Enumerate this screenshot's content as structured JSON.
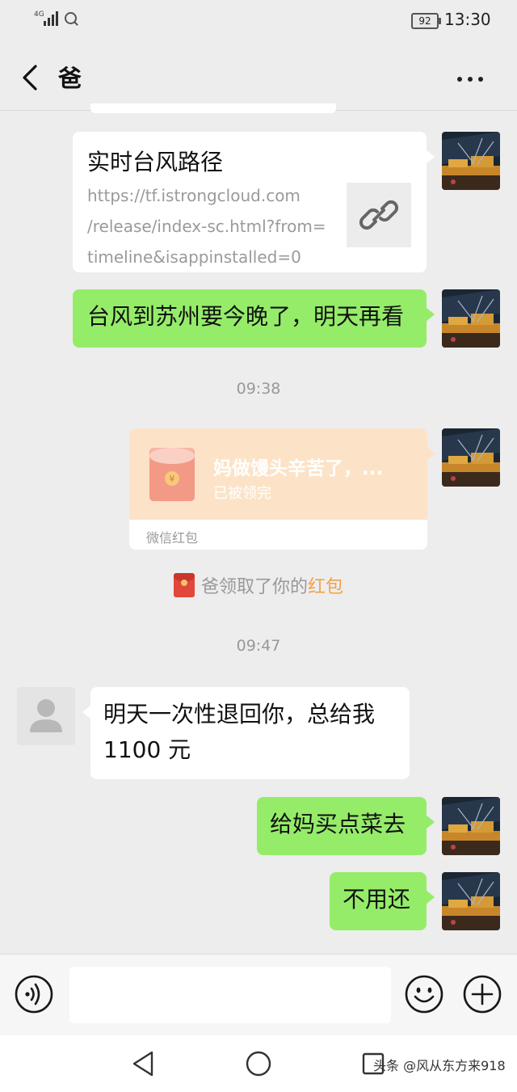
{
  "status_bar": {
    "network": "4G",
    "battery": "92",
    "time": "13:30"
  },
  "header": {
    "title": "爸"
  },
  "link_card": {
    "title": "实时台风路径",
    "url_lines": [
      "https://tf.istrongcloud.com",
      "/release/index-sc.html?from=",
      "timeline&isappinstalled=0"
    ]
  },
  "messages": {
    "m1": "台风到苏州要今晚了，明天再看",
    "t1": "09:38",
    "t2": "09:47",
    "m2_line1": "明天一次性退回你，总给我",
    "m2_line2": "1100 元",
    "m3": "给妈买点菜去",
    "m4": "不用还"
  },
  "red_packet": {
    "title": "妈做馒头辛苦了，...",
    "status": "已被领完",
    "footer": "微信红包"
  },
  "notice": {
    "prefix": "爸领取了你的",
    "link": "红包"
  },
  "input": {
    "placeholder": "",
    "value": ""
  },
  "watermark": "头条 @风从东方来918",
  "colors": {
    "bubble_out": "#95ec69",
    "background": "#ededed",
    "red_packet": "#fce3c7",
    "notice_link": "#f5a142"
  }
}
